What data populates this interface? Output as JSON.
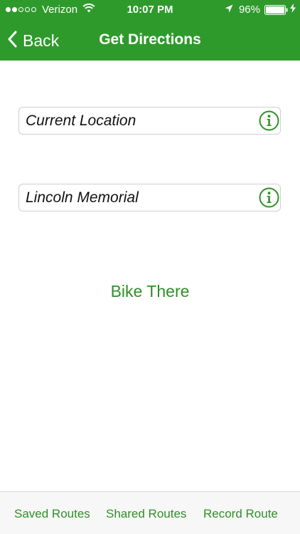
{
  "status_bar": {
    "carrier": "Verizon",
    "time": "10:07 PM",
    "battery_percent": "96%",
    "signal_bars_filled": 2,
    "signal_bars_total": 5
  },
  "nav_bar": {
    "back_label": "Back",
    "title": "Get Directions"
  },
  "form": {
    "start_value": "Current Location",
    "destination_value": "Lincoln Memorial"
  },
  "action": {
    "bike_there_label": "Bike There"
  },
  "tab_bar": {
    "tabs": [
      {
        "label": "Saved Routes"
      },
      {
        "label": "Shared Routes"
      },
      {
        "label": "Record Route"
      }
    ]
  },
  "colors": {
    "brand_green": "#2f9a2c",
    "accent_green": "#2f8f27",
    "header_text": "#ffffff"
  }
}
